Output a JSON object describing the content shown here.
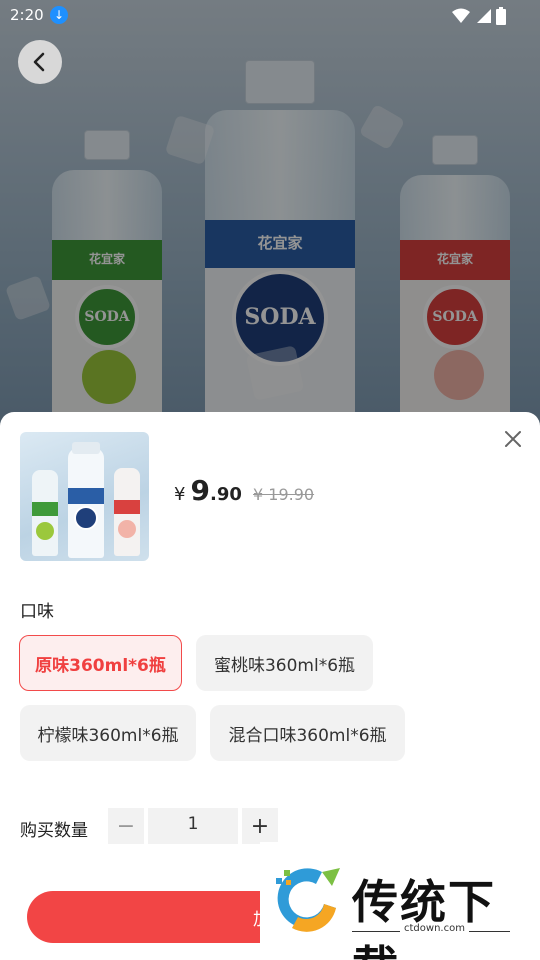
{
  "statusbar": {
    "time": "2:20"
  },
  "hero": {
    "brand_logo": "花宜家",
    "badge_text": "SODA"
  },
  "sheet": {
    "price": {
      "symbol": "¥",
      "integer": "9",
      "decimal": ".90",
      "original": "¥ 19.90"
    },
    "flavor_label": "口味",
    "flavors": [
      {
        "label": "原味360ml*6瓶",
        "selected": true
      },
      {
        "label": "蜜桃味360ml*6瓶",
        "selected": false
      },
      {
        "label": "柠檬味360ml*6瓶",
        "selected": false
      },
      {
        "label": "混合口味360ml*6瓶",
        "selected": false
      }
    ],
    "quantity_label": "购买数量",
    "quantity": "1",
    "minus": "−",
    "plus": "+",
    "cart_button": "加入"
  },
  "watermark": {
    "title": "传统下载",
    "url": "ctdown.com"
  },
  "colors": {
    "accent": "#f24545",
    "selected_chip_bg": "#fdeeee"
  }
}
